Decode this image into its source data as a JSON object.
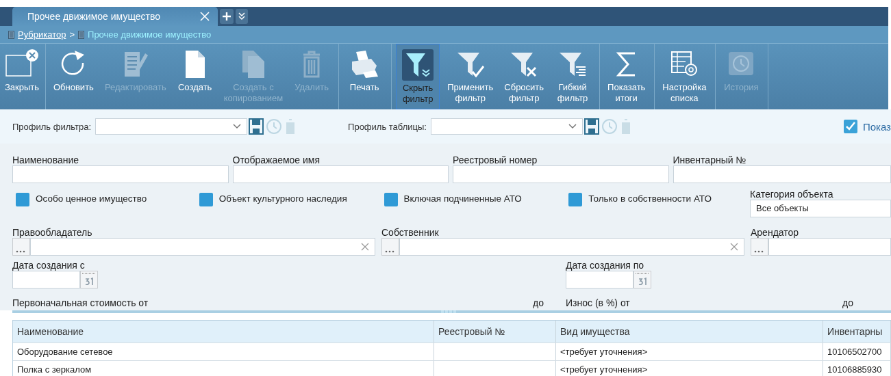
{
  "tabs": [
    {
      "label": "Прочее движимое имущество",
      "selected": true
    }
  ],
  "breadcrumb": [
    {
      "label": "Рубрикатор",
      "current": false,
      "separator": ">"
    },
    {
      "label": "Прочее движимое имущество",
      "current": true
    }
  ],
  "toolbar": [
    {
      "group": [
        {
          "kind": "close",
          "lines": [
            "Закрыть"
          ],
          "disabled": false,
          "selected": false
        }
      ]
    },
    {
      "group": [
        {
          "kind": "refresh",
          "lines": [
            "Обновить"
          ],
          "disabled": false,
          "selected": false
        },
        {
          "kind": "edit",
          "lines": [
            "Редактировать"
          ],
          "disabled": true,
          "selected": false
        },
        {
          "kind": "create",
          "lines": [
            "Создать"
          ],
          "disabled": false,
          "selected": false
        },
        {
          "kind": "copy",
          "lines": [
            "Создать с",
            "копированием"
          ],
          "disabled": true,
          "selected": false
        },
        {
          "kind": "delete",
          "lines": [
            "Удалить"
          ],
          "disabled": true,
          "selected": false
        }
      ]
    },
    {
      "group": [
        {
          "kind": "print",
          "lines": [
            "Печать"
          ],
          "disabled": false,
          "selected": false
        }
      ]
    },
    {
      "group": [
        {
          "kind": "filter-hide",
          "lines": [
            "Скрыть",
            "фильтр"
          ],
          "disabled": false,
          "selected": true
        },
        {
          "kind": "filter-apply",
          "lines": [
            "Применить",
            "фильтр"
          ],
          "disabled": false,
          "selected": false
        },
        {
          "kind": "filter-reset",
          "lines": [
            "Сбросить",
            "фильтр"
          ],
          "disabled": false,
          "selected": false
        },
        {
          "kind": "filter-flex",
          "lines": [
            "Гибкий",
            "фильтр"
          ],
          "disabled": false,
          "selected": false
        }
      ]
    },
    {
      "group": [
        {
          "kind": "sum",
          "lines": [
            "Показать",
            "итоги"
          ],
          "disabled": false,
          "selected": false
        }
      ]
    },
    {
      "group": [
        {
          "kind": "settings",
          "lines": [
            "Настройка",
            "списка"
          ],
          "disabled": false,
          "selected": false
        }
      ]
    },
    {
      "group": [
        {
          "kind": "history",
          "lines": [
            "История"
          ],
          "disabled": true,
          "selected": false
        }
      ]
    }
  ],
  "profiles": [
    {
      "label": "Профиль фильтра:"
    },
    {
      "label": "Профиль таблицы:"
    }
  ],
  "show_toggle": {
    "label": "Показ",
    "checked": true
  },
  "text_fields": [
    {
      "label": "Наименование"
    },
    {
      "label": "Отображаемое имя"
    },
    {
      "label": "Реестровый номер"
    },
    {
      "label": "Инвентарный №"
    }
  ],
  "checkboxes": [
    {
      "label": "Особо ценное имущество",
      "checked": false
    },
    {
      "label": "Объект культурного наследия",
      "checked": false
    },
    {
      "label": "Включая подчиненные АТО",
      "checked": false
    },
    {
      "label": "Только в собственности АТО",
      "checked": false
    }
  ],
  "category": {
    "label": "Категория объекта",
    "value": "Все объекты"
  },
  "lookups": [
    {
      "label": "Правообладатель",
      "clearable": true
    },
    {
      "label": "Собственник",
      "clearable": true
    },
    {
      "label": "Арендатор",
      "clearable": false
    }
  ],
  "dates": [
    {
      "label": "Дата создания с"
    },
    {
      "label": "Дата создания по"
    }
  ],
  "ranges": [
    {
      "label": "Первоначальная стоимость от",
      "to": "до"
    },
    {
      "label": "Износ (в %) от",
      "to": "до"
    }
  ],
  "table": {
    "columns": [
      "Наименование",
      "Реестровый №",
      "Вид имущества",
      "Инвентарны"
    ],
    "rows": [
      [
        "Оборудование сетевое",
        "",
        "<требует уточнения>",
        "10106502700"
      ],
      [
        "Полка с зеркалом",
        "",
        "<требует уточнения>",
        "10106885930"
      ]
    ]
  }
}
